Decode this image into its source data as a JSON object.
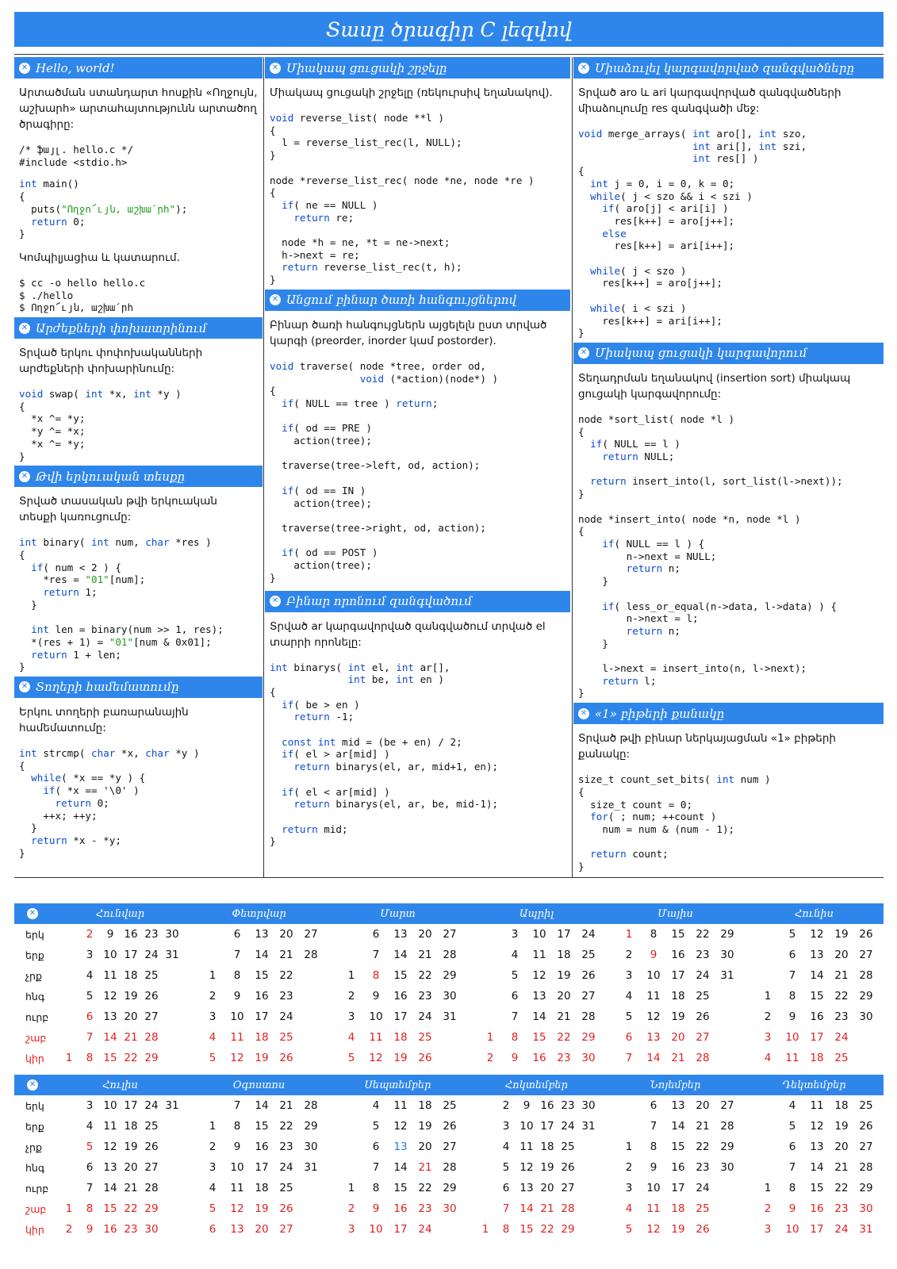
{
  "title": "Տասը ծրագիր C լեզվով",
  "sections": {
    "hello": {
      "title": "Hello, world!",
      "desc": "Արտածման ստանդարտ հոսքին «Ողջույն, աշխարհ» արտահայտությունն արտածող ծրագիրը:",
      "code1": "/* ֆայլ. hello.c */\n#include <stdio.h>",
      "code2": "int main()\n{\n  puts(\"Ողջո՜ւյն, աշխա՛րհ\");\n  return 0;\n}",
      "note": "Կոմպիլյացիա և կատարում.",
      "code3": "$ cc -o hello hello.c\n$ ./hello\n$ Ողջո՜ւյն, աշխա՛րհ"
    },
    "swap": {
      "title": "Արժեքների փոխատրինում",
      "desc": "Տրված երկու փոփոխականների արժեքների փոխարինումը:",
      "code": "void swap( int *x, int *y )\n{\n  *x ^= *y;\n  *y ^= *x;\n  *x ^= *y;\n}"
    },
    "binary": {
      "title": "Թվի երկուական տեսքը",
      "desc": "Տրված տասական թվի երկուական տեսքի կառուցումը:",
      "code": "int binary( int num, char *res )\n{\n  if( num < 2 ) {\n    *res = \"01\"[num];\n    return 1;\n  }\n\n  int len = binary(num >> 1, res);\n  *(res + 1) = \"01\"[num & 0x01];\n  return 1 + len;\n}"
    },
    "strcmp": {
      "title": "Տողերի համեմատումը",
      "desc": "Երկու տողերի բառարանային համեմատումը:",
      "code": "int strcmp( char *x, char *y )\n{\n  while( *x == *y ) {\n    if( *x == '\\0' )\n      return 0;\n    ++x; ++y;\n  }\n  return *x - *y;\n}"
    },
    "reverse": {
      "title": "Միակապ ցուցակի շրջելը",
      "desc": "Միակապ ցուցակի շրջելը (ռեկուրսիվ եղանակով).",
      "code": "void reverse_list( node **l )\n{\n  l = reverse_list_rec(l, NULL);\n}\n\nnode *reverse_list_rec( node *ne, node *re )\n{\n  if( ne == NULL )\n    return re;\n\n  node *h = ne, *t = ne->next;\n  h->next = re;\n  return reverse_list_rec(t, h);\n}"
    },
    "traverse": {
      "title": "Անցում բինար ծառի հանգույցներով",
      "desc": "Բինար ծառի հանգույցներն այցելելն ըստ տրված կարգի (preorder, inorder կամ postorder).",
      "code": "void traverse( node *tree, order od,\n               void (*action)(node*) )\n{\n  if( NULL == tree ) return;\n\n  if( od == PRE )\n    action(tree);\n\n  traverse(tree->left, od, action);\n\n  if( od == IN )\n    action(tree);\n\n  traverse(tree->right, od, action);\n\n  if( od == POST )\n    action(tree);\n}"
    },
    "binsearch": {
      "title": "Բինար որոնում զանգվածում",
      "desc": "Տրված ar կարգավորված զանգվածում տրված el տարրի որոնելը:",
      "code": "int binarys( int el, int ar[],\n             int be, int en )\n{\n  if( be > en )\n    return -1;\n\n  const int mid = (be + en) / 2;\n  if( el > ar[mid] )\n    return binarys(el, ar, mid+1, en);\n\n  if( el < ar[mid] )\n    return binarys(el, ar, be, mid-1);\n\n  return mid;\n}"
    },
    "merge": {
      "title": "Միաձուլել կարգավորված զանգվածները",
      "desc": "Տրված aro և ari կարգավորված զանգվածների միաձուլումը res զանգվածի մեջ:",
      "code": "void merge_arrays( int aro[], int szo,\n                   int ari[], int szi,\n                   int res[] )\n{\n  int j = 0, i = 0, k = 0;\n  while( j < szo && i < szi )\n    if( aro[j] < ari[i] )\n      res[k++] = aro[j++];\n    else\n      res[k++] = ari[i++];\n\n  while( j < szo )\n    res[k++] = aro[j++];\n\n  while( i < szi )\n    res[k++] = ari[i++];\n}"
    },
    "sortlist": {
      "title": "Միակապ ցուցակի կարգավորում",
      "desc": "Տեղադրման եղանակով (insertion sort) միակապ ցուցակի կարգավորումը:",
      "code": "node *sort_list( node *l )\n{\n  if( NULL == l )\n    return NULL;\n\n  return insert_into(l, sort_list(l->next));\n}\n\nnode *insert_into( node *n, node *l )\n{\n    if( NULL == l ) {\n        n->next = NULL;\n        return n;\n    }\n\n    if( less_or_equal(n->data, l->data) ) {\n        n->next = l;\n        return n;\n    }\n\n    l->next = insert_into(n, l->next);\n    return l;\n}"
    },
    "countbits": {
      "title": "«1» բիթերի քանակը",
      "desc": "Տրված թվի բինար ներկայացման «1» բիթերի քանակը:",
      "code": "size_t count_set_bits( int num )\n{\n  size_t count = 0;\n  for( ; num; ++count )\n    num = num & (num - 1);\n\n  return count;\n}"
    }
  },
  "calendar": {
    "day_names": [
      "երկ",
      "երք",
      "չրք",
      "հնգ",
      "ուրբ",
      "շաբ",
      "կիր"
    ],
    "colors": {
      "accent": "#2f86ea",
      "weekend": "#e02020",
      "highlight": "#1f7ee0"
    },
    "halves": [
      {
        "months": [
          {
            "name": "Հունվար",
            "rows": [
              [
                "",
                "2",
                "9",
                "16",
                "23",
                "30"
              ],
              [
                "",
                "3",
                "10",
                "17",
                "24",
                "31"
              ],
              [
                "",
                "4",
                "11",
                "18",
                "25",
                ""
              ],
              [
                "",
                "5",
                "12",
                "19",
                "26",
                ""
              ],
              [
                "",
                "6",
                "13",
                "20",
                "27",
                ""
              ],
              [
                "",
                "7",
                "14",
                "21",
                "28",
                ""
              ],
              [
                "1",
                "8",
                "15",
                "22",
                "29",
                ""
              ]
            ]
          },
          {
            "name": "Փետրվար",
            "rows": [
              [
                "",
                "6",
                "13",
                "20",
                "27"
              ],
              [
                "",
                "7",
                "14",
                "21",
                "28"
              ],
              [
                "1",
                "8",
                "15",
                "22",
                ""
              ],
              [
                "2",
                "9",
                "16",
                "23",
                ""
              ],
              [
                "3",
                "10",
                "17",
                "24",
                ""
              ],
              [
                "4",
                "11",
                "18",
                "25",
                ""
              ],
              [
                "5",
                "12",
                "19",
                "26",
                ""
              ]
            ]
          },
          {
            "name": "Մարտ",
            "rows": [
              [
                "",
                "6",
                "13",
                "20",
                "27"
              ],
              [
                "",
                "7",
                "14",
                "21",
                "28"
              ],
              [
                "1",
                "8",
                "15",
                "22",
                "29"
              ],
              [
                "2",
                "9",
                "16",
                "23",
                "30"
              ],
              [
                "3",
                "10",
                "17",
                "24",
                "31"
              ],
              [
                "4",
                "11",
                "18",
                "25",
                ""
              ],
              [
                "5",
                "12",
                "19",
                "26",
                ""
              ]
            ]
          },
          {
            "name": "Ապրիլ",
            "rows": [
              [
                "",
                "3",
                "10",
                "17",
                "24"
              ],
              [
                "",
                "4",
                "11",
                "18",
                "25"
              ],
              [
                "",
                "5",
                "12",
                "19",
                "26"
              ],
              [
                "",
                "6",
                "13",
                "20",
                "27"
              ],
              [
                "",
                "7",
                "14",
                "21",
                "28"
              ],
              [
                "1",
                "8",
                "15",
                "22",
                "29"
              ],
              [
                "2",
                "9",
                "16",
                "23",
                "30"
              ]
            ]
          },
          {
            "name": "Մայիս",
            "rows": [
              [
                "1",
                "8",
                "15",
                "22",
                "29"
              ],
              [
                "2",
                "9",
                "16",
                "23",
                "30"
              ],
              [
                "3",
                "10",
                "17",
                "24",
                "31"
              ],
              [
                "4",
                "11",
                "18",
                "25",
                ""
              ],
              [
                "5",
                "12",
                "19",
                "26",
                ""
              ],
              [
                "6",
                "13",
                "20",
                "27",
                ""
              ],
              [
                "7",
                "14",
                "21",
                "28",
                ""
              ]
            ]
          },
          {
            "name": "Հունիս",
            "rows": [
              [
                "",
                "5",
                "12",
                "19",
                "26"
              ],
              [
                "",
                "6",
                "13",
                "20",
                "27"
              ],
              [
                "",
                "7",
                "14",
                "21",
                "28"
              ],
              [
                "1",
                "8",
                "15",
                "22",
                "29"
              ],
              [
                "2",
                "9",
                "16",
                "23",
                "30"
              ],
              [
                "3",
                "10",
                "17",
                "24",
                ""
              ],
              [
                "4",
                "11",
                "18",
                "25",
                ""
              ]
            ]
          }
        ]
      },
      {
        "months": [
          {
            "name": "Հուլիս",
            "rows": [
              [
                "",
                "3",
                "10",
                "17",
                "24",
                "31"
              ],
              [
                "",
                "4",
                "11",
                "18",
                "25",
                ""
              ],
              [
                "",
                "5",
                "12",
                "19",
                "26",
                ""
              ],
              [
                "",
                "6",
                "13",
                "20",
                "27",
                ""
              ],
              [
                "",
                "7",
                "14",
                "21",
                "28",
                ""
              ],
              [
                "1",
                "8",
                "15",
                "22",
                "29",
                ""
              ],
              [
                "2",
                "9",
                "16",
                "23",
                "30",
                ""
              ]
            ]
          },
          {
            "name": "Օգոստոս",
            "rows": [
              [
                "",
                "7",
                "14",
                "21",
                "28"
              ],
              [
                "1",
                "8",
                "15",
                "22",
                "29"
              ],
              [
                "2",
                "9",
                "16",
                "23",
                "30"
              ],
              [
                "3",
                "10",
                "17",
                "24",
                "31"
              ],
              [
                "4",
                "11",
                "18",
                "25",
                ""
              ],
              [
                "5",
                "12",
                "19",
                "26",
                ""
              ],
              [
                "6",
                "13",
                "20",
                "27",
                ""
              ]
            ]
          },
          {
            "name": "Սեպտեմբեր",
            "rows": [
              [
                "",
                "4",
                "11",
                "18",
                "25"
              ],
              [
                "",
                "5",
                "12",
                "19",
                "26"
              ],
              [
                "",
                "6",
                "13",
                "20",
                "27"
              ],
              [
                "",
                "7",
                "14",
                "21",
                "28"
              ],
              [
                "1",
                "8",
                "15",
                "22",
                "29"
              ],
              [
                "2",
                "9",
                "16",
                "23",
                "30"
              ],
              [
                "3",
                "10",
                "17",
                "24",
                ""
              ]
            ]
          },
          {
            "name": "Հոկտեմբեր",
            "rows": [
              [
                "",
                "2",
                "9",
                "16",
                "23",
                "30"
              ],
              [
                "",
                "3",
                "10",
                "17",
                "24",
                "31"
              ],
              [
                "",
                "4",
                "11",
                "18",
                "25",
                ""
              ],
              [
                "",
                "5",
                "12",
                "19",
                "26",
                ""
              ],
              [
                "",
                "6",
                "13",
                "20",
                "27",
                ""
              ],
              [
                "",
                "7",
                "14",
                "21",
                "28",
                ""
              ],
              [
                "1",
                "8",
                "15",
                "22",
                "29",
                ""
              ]
            ]
          },
          {
            "name": "Նոյեմբեր",
            "rows": [
              [
                "",
                "6",
                "13",
                "20",
                "27"
              ],
              [
                "",
                "7",
                "14",
                "21",
                "28"
              ],
              [
                "1",
                "8",
                "15",
                "22",
                "29"
              ],
              [
                "2",
                "9",
                "16",
                "23",
                "30"
              ],
              [
                "3",
                "10",
                "17",
                "24",
                ""
              ],
              [
                "4",
                "11",
                "18",
                "25",
                ""
              ],
              [
                "5",
                "12",
                "19",
                "26",
                ""
              ]
            ]
          },
          {
            "name": "Դեկտեմբեր",
            "rows": [
              [
                "",
                "4",
                "11",
                "18",
                "25"
              ],
              [
                "",
                "5",
                "12",
                "19",
                "26"
              ],
              [
                "",
                "6",
                "13",
                "20",
                "27"
              ],
              [
                "",
                "7",
                "14",
                "21",
                "28"
              ],
              [
                "1",
                "8",
                "15",
                "22",
                "29"
              ],
              [
                "2",
                "9",
                "16",
                "23",
                "30"
              ],
              [
                "3",
                "10",
                "17",
                "24",
                "31"
              ]
            ]
          }
        ]
      }
    ],
    "red_dates": {
      "Հունվար": [
        "2",
        "6"
      ],
      "Մարտ": [
        "8"
      ],
      "Մայիս": [
        "1",
        "9"
      ],
      "Հուլիս": [
        "5"
      ],
      "Սեպտեմբեր": [
        "21"
      ]
    },
    "blue_dates": {
      "Սեպտեմբեր": [
        "13"
      ]
    }
  }
}
